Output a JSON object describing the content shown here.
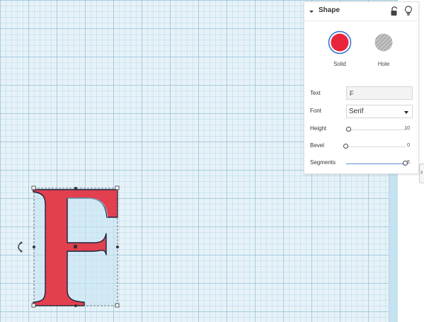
{
  "panel": {
    "title": "Shape",
    "modes": {
      "solid_label": "Solid",
      "hole_label": "Hole"
    },
    "properties": {
      "text": {
        "label": "Text",
        "value": "F"
      },
      "font": {
        "label": "Font",
        "value": "Serif"
      },
      "height": {
        "label": "Height",
        "value": "10",
        "fraction": 0.05
      },
      "bevel": {
        "label": "Bevel",
        "value": "0",
        "fraction": 0.0
      },
      "segments": {
        "label": "Segments",
        "value": "5",
        "fraction": 1.0
      }
    }
  },
  "colors": {
    "solid": "#e8253a",
    "letter_fill": "#e2404e",
    "slider_fill": "#5a8fd6",
    "workplane": "#e6f2f8"
  },
  "icons": [
    "chevron-down-icon",
    "lock-icon",
    "lightbulb-icon",
    "rotate-icon"
  ]
}
